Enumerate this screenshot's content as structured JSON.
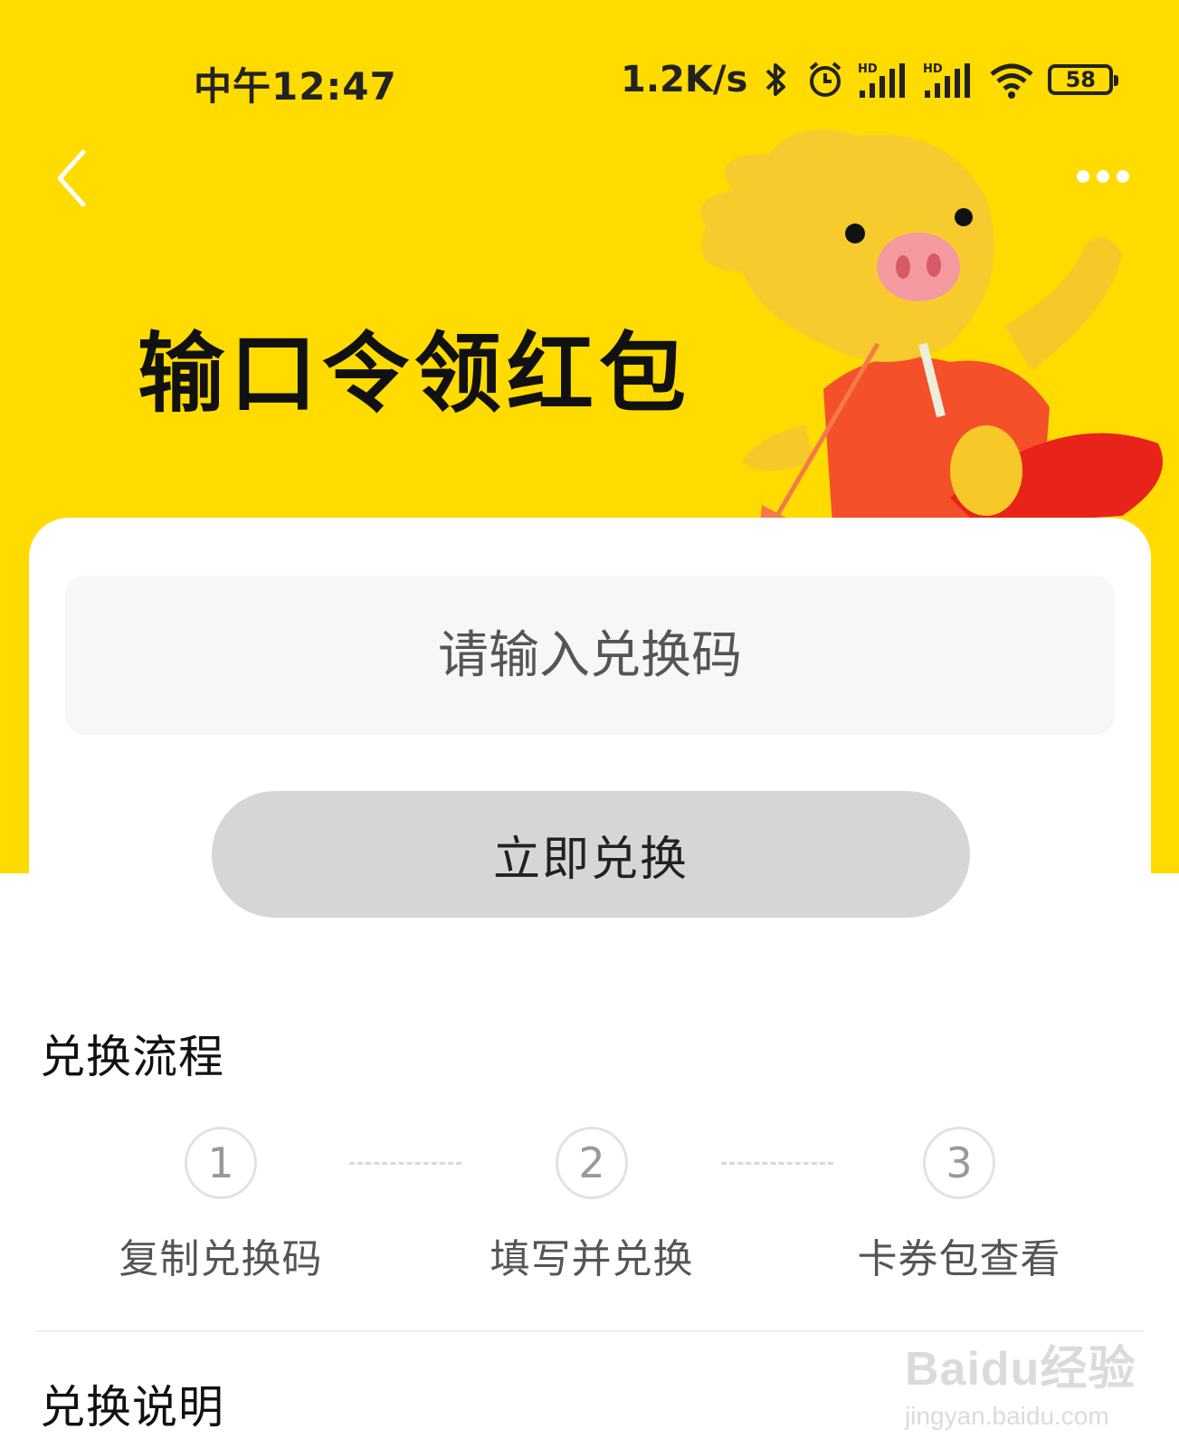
{
  "status_bar": {
    "time": "中午12:47",
    "net_speed": "1.2K/s",
    "battery": "58",
    "signal_badge": "HD"
  },
  "header": {
    "title": "输口令领红包"
  },
  "form": {
    "input_placeholder": "请输入兑换码",
    "redeem_label": "立即兑换"
  },
  "process": {
    "title": "兑换流程",
    "steps": [
      {
        "number": "1",
        "label": "复制兑换码"
      },
      {
        "number": "2",
        "label": "填写并兑换"
      },
      {
        "number": "3",
        "label": "卡券包查看"
      }
    ]
  },
  "notes": {
    "title": "兑换说明"
  },
  "watermark": {
    "logo": "Baidu经验",
    "url": "jingyan.baidu.com"
  },
  "colors": {
    "brand_yellow": "#FFDB00",
    "button_gray": "#D6D6D6",
    "input_bg": "#F6F7F9",
    "annotation_arrow": "#F47A4A"
  },
  "icons": [
    "back-arrow-icon",
    "more-dots-icon",
    "bluetooth-icon",
    "alarm-icon",
    "signal-icon",
    "wifi-icon",
    "battery-icon"
  ]
}
